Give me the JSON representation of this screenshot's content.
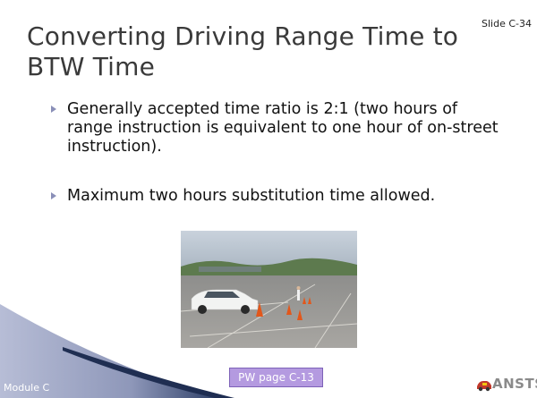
{
  "slide": {
    "number": "Slide C-34",
    "title": "Converting Driving Range Time to BTW Time",
    "bullets": [
      "Generally accepted time ratio is 2:1 (two hours of range instruction is equivalent to one hour of on-street instruction).",
      "Maximum two hours substitution time allowed."
    ],
    "module_label": "Module C",
    "pw_button_label": "PW page C-13",
    "logo_text": "ANSTSE",
    "photo_icon": "driving-range-photo"
  },
  "colors": {
    "band_dark": "#2c3e66",
    "band_light": "#8e97b9",
    "bullet_marker": "#8a8fb8",
    "button_fill": "#b49ae0",
    "title_text": "#3a3a3a"
  }
}
